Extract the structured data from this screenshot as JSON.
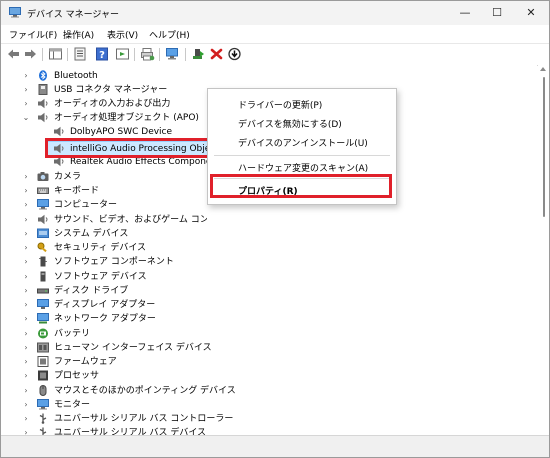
{
  "window": {
    "title": "デバイス マネージャー",
    "controls": {
      "minimize": "—",
      "maximize": "☐",
      "close": "✕"
    }
  },
  "menu": [
    "ファイル(F)",
    "操作(A)",
    "表示(V)",
    "ヘルプ(H)"
  ],
  "toolbar": {
    "icons": [
      "back-icon",
      "forward-icon",
      "show-tree-icon",
      "properties-icon",
      "help-icon",
      "view-icon",
      "print-icon",
      "scan-hardware-icon",
      "add-driver-icon",
      "uninstall-icon",
      "update-driver-icon"
    ]
  },
  "tree": {
    "items": [
      {
        "label": "Bluetooth",
        "icon": "bluetooth-icon",
        "expander": "›"
      },
      {
        "label": "USB コネクタ マネージャー",
        "icon": "usb-connector-icon",
        "expander": "›"
      },
      {
        "label": "オーディオの入力および出力",
        "icon": "speaker-icon",
        "expander": "›"
      },
      {
        "label": "オーディオ処理オブジェクト (APO)",
        "icon": "speaker-icon",
        "expander": "⌄"
      },
      {
        "label": "DolbyAPO SWC Device",
        "icon": "speaker-icon",
        "expander": ""
      },
      {
        "label": "intelliGo Audio Processing Object",
        "icon": "speaker-icon",
        "expander": "",
        "selected": true
      },
      {
        "label": "Realtek Audio Effects Component",
        "icon": "speaker-icon",
        "expander": ""
      },
      {
        "label": "カメラ",
        "icon": "camera-icon",
        "expander": "›"
      },
      {
        "label": "キーボード",
        "icon": "keyboard-icon",
        "expander": "›"
      },
      {
        "label": "コンピューター",
        "icon": "computer-icon",
        "expander": "›"
      },
      {
        "label": "サウンド、ビデオ、およびゲーム コントローラー",
        "icon": "sound-icon",
        "expander": "›"
      },
      {
        "label": "システム デバイス",
        "icon": "system-device-icon",
        "expander": "›"
      },
      {
        "label": "セキュリティ デバイス",
        "icon": "security-key-icon",
        "expander": "›"
      },
      {
        "label": "ソフトウェア コンポーネント",
        "icon": "software-component-icon",
        "expander": "›"
      },
      {
        "label": "ソフトウェア デバイス",
        "icon": "software-device-icon",
        "expander": "›"
      },
      {
        "label": "ディスク ドライブ",
        "icon": "disk-drive-icon",
        "expander": "›"
      },
      {
        "label": "ディスプレイ アダプター",
        "icon": "display-adapter-icon",
        "expander": "›"
      },
      {
        "label": "ネットワーク アダプター",
        "icon": "network-adapter-icon",
        "expander": "›"
      },
      {
        "label": "バッテリ",
        "icon": "battery-icon",
        "expander": "›"
      },
      {
        "label": "ヒューマン インターフェイス デバイス",
        "icon": "hid-icon",
        "expander": "›"
      },
      {
        "label": "ファームウェア",
        "icon": "firmware-icon",
        "expander": "›"
      },
      {
        "label": "プロセッサ",
        "icon": "processor-icon",
        "expander": "›"
      },
      {
        "label": "マウスとそのほかのポインティング デバイス",
        "icon": "mouse-icon",
        "expander": "›"
      },
      {
        "label": "モニター",
        "icon": "monitor-icon",
        "expander": "›"
      },
      {
        "label": "ユニバーサル シリアル バス コントローラー",
        "icon": "usb-controller-icon",
        "expander": "›"
      },
      {
        "label": "ユニバーサル シリアル バス デバイス",
        "icon": "usb-device-icon",
        "expander": "›"
      }
    ]
  },
  "context_menu": {
    "items": [
      "ドライバーの更新(P)",
      "デバイスを無効にする(D)",
      "デバイスのアンインストール(U)",
      "ハードウェア変更のスキャン(A)",
      "プロパティ(R)"
    ]
  },
  "colors": {
    "highlight_border": "#e0202a",
    "selection": "#cce8ff"
  }
}
